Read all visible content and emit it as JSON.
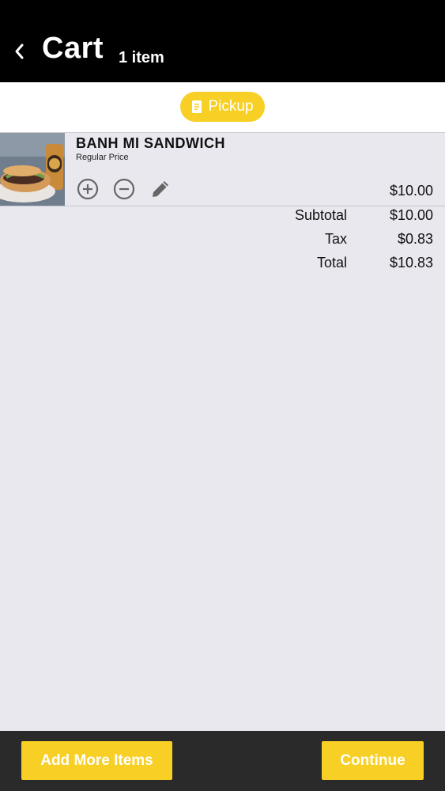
{
  "header": {
    "title": "Cart",
    "item_count": "1 item"
  },
  "order_mode": {
    "label": "Pickup",
    "icon": "receipt-icon",
    "color": "#f8cf24"
  },
  "cart": {
    "items": [
      {
        "name": "BANH MI SANDWICH",
        "variant": "Regular Price",
        "price": "$10.00",
        "actions": [
          "plus-circle-icon",
          "minus-circle-icon",
          "pencil-icon"
        ]
      }
    ]
  },
  "summary": {
    "subtotal_label": "Subtotal",
    "subtotal_value": "$10.00",
    "tax_label": "Tax",
    "tax_value": "$0.83",
    "total_label": "Total",
    "total_value": "$10.83"
  },
  "footer": {
    "add_more_label": "Add More Items",
    "continue_label": "Continue"
  },
  "colors": {
    "accent": "#f8cf24",
    "header_bg": "#000000",
    "footer_bg": "#2a2a2a",
    "page_bg": "#e9e8ef"
  }
}
